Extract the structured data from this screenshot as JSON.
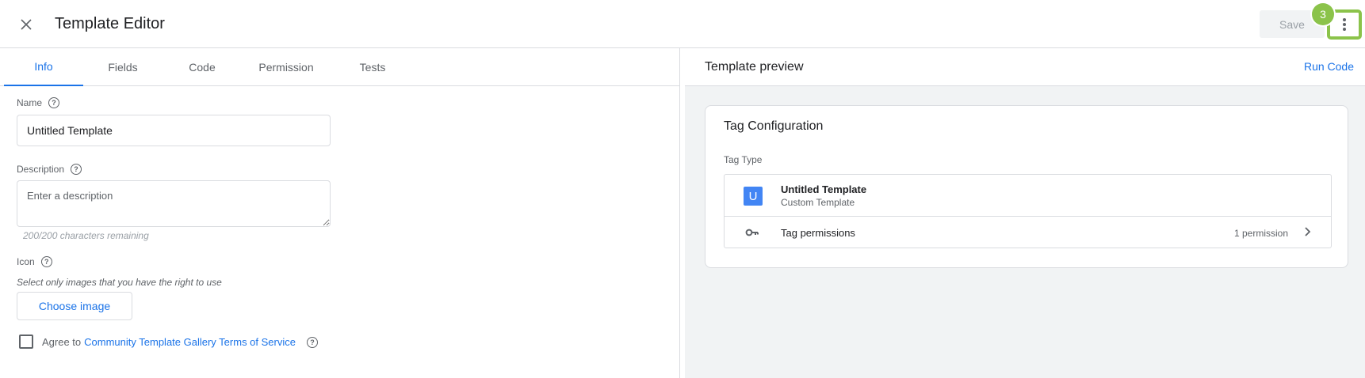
{
  "header": {
    "title": "Template Editor",
    "save_label": "Save",
    "step_badge": "3"
  },
  "tabs": [
    {
      "label": "Info",
      "active": true
    },
    {
      "label": "Fields",
      "active": false
    },
    {
      "label": "Code",
      "active": false
    },
    {
      "label": "Permission",
      "active": false
    },
    {
      "label": "Tests",
      "active": false
    }
  ],
  "info": {
    "name_label": "Name",
    "name_value": "Untitled Template",
    "description_label": "Description",
    "description_placeholder": "Enter a description",
    "chars_remaining": "200/200 characters remaining",
    "icon_label": "Icon",
    "icon_helper": "Select only images that you have the right to use",
    "choose_image_label": "Choose image",
    "agree_prefix": "Agree to",
    "agree_link": "Community Template Gallery Terms of Service"
  },
  "preview": {
    "title": "Template preview",
    "run_code_label": "Run Code",
    "card_title": "Tag Configuration",
    "tag_type_label": "Tag Type",
    "tag_icon_letter": "U",
    "tag_name": "Untitled Template",
    "tag_subtitle": "Custom Template",
    "permissions_label": "Tag permissions",
    "permissions_count": "1 permission"
  },
  "colors": {
    "accent": "#1a73e8",
    "highlight": "#8bc34a",
    "tag_icon_bg": "#4285f4"
  },
  "icons": {
    "close": "close-icon",
    "more": "more-vert-icon",
    "help": "help-circle-icon",
    "key": "key-icon",
    "chevron": "chevron-right-icon"
  }
}
